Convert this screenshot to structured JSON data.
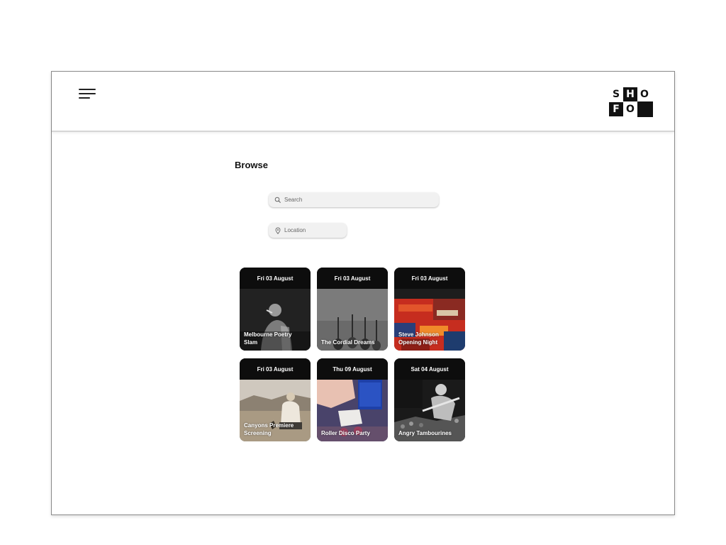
{
  "header": {
    "menu_icon": "hamburger-menu-icon",
    "logo": {
      "letters": [
        "S",
        "H",
        "O",
        "F",
        "O"
      ]
    }
  },
  "main": {
    "title": "Browse",
    "search": {
      "placeholder": "Search",
      "icon": "search-icon"
    },
    "location": {
      "placeholder": "Location",
      "icon": "location-pin-icon"
    },
    "events": [
      {
        "date": "Fri 03 August",
        "title": "Melbourne Poetry Slam"
      },
      {
        "date": "Fri 03 August",
        "title": "The Cordial Dreams"
      },
      {
        "date": "Fri 03 August",
        "title": "Steve Johnson Opening Night"
      },
      {
        "date": "Fri 03 August",
        "title": "Canyons Premiere Screening"
      },
      {
        "date": "Thu 09 August",
        "title": "Roller Disco Party"
      },
      {
        "date": "Sat 04 August",
        "title": "Angry Tambourines"
      }
    ]
  },
  "colors": {
    "card_header": "#0d0d0d",
    "accent": "#111111"
  }
}
